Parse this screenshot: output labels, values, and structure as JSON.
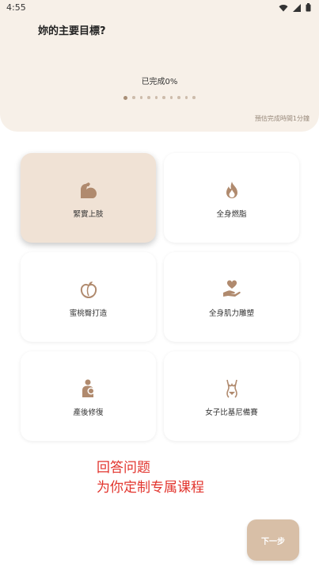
{
  "status_bar": {
    "time": "4:55"
  },
  "header": {
    "title": "妳的主要目標?",
    "progress_text": "已完成0%",
    "estimate_text": "預估完成時間1分鐘",
    "step_count": 10,
    "active_step": 0,
    "dot_color": "#cdbcab",
    "active_dot_color": "#a88e76"
  },
  "goals": [
    {
      "label": "緊實上肢",
      "icon": "flexed-arm-icon",
      "selected": true
    },
    {
      "label": "全身燃脂",
      "icon": "flame-icon",
      "selected": false
    },
    {
      "label": "蜜桃臀打造",
      "icon": "peach-icon",
      "selected": false
    },
    {
      "label": "全身肌力雕塑",
      "icon": "heart-hand-icon",
      "selected": false
    },
    {
      "label": "產後修復",
      "icon": "mother-baby-icon",
      "selected": false
    },
    {
      "label": "女子比基尼備賽",
      "icon": "bikini-body-icon",
      "selected": false
    }
  ],
  "promo": {
    "line1": "回答问题",
    "line2": "为你定制专属课程"
  },
  "next_button": {
    "label": "下一步"
  },
  "colors": {
    "header_bg": "#f7f0e8",
    "selected_card_bg": "#f0e2d5",
    "icon_brown": "#b08a6e",
    "promo_red": "#e2342d",
    "button_bg": "#d8bfa7"
  }
}
